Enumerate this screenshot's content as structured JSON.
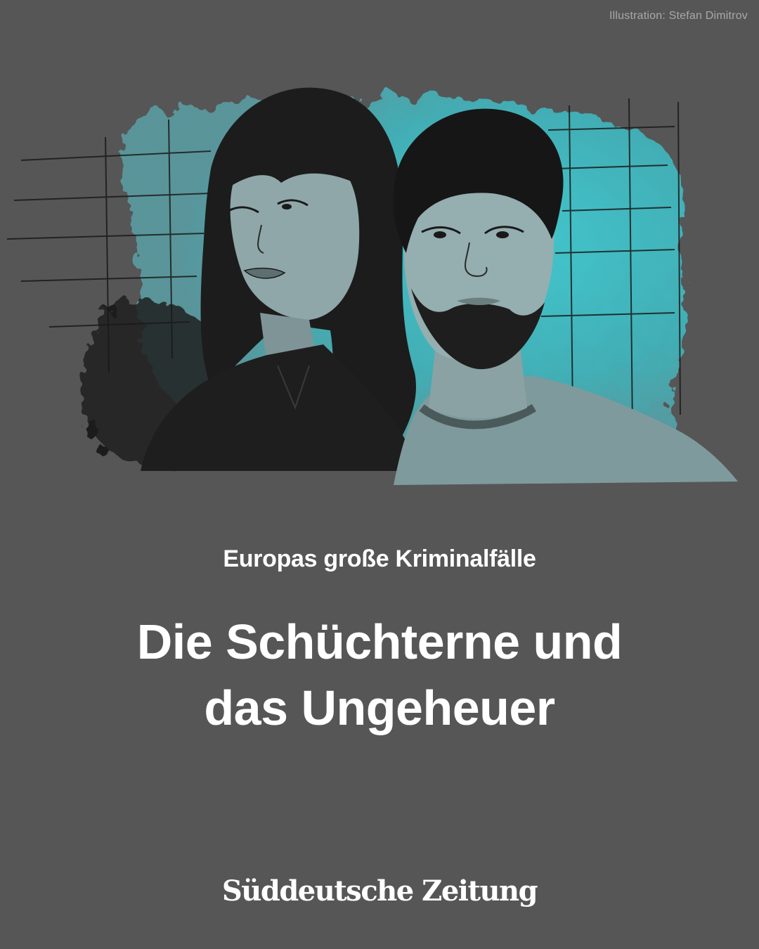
{
  "credit": "Illustration: Stefan Dimitrov",
  "kicker": "Europas große Kriminalfälle",
  "headline": {
    "line1": "Die Schüchterne und",
    "line2": "das Ungeheuer"
  },
  "brand": "Süddeutsche Zeitung",
  "colors": {
    "background": "#565656",
    "accent": "#3fc4cc",
    "text": "#ffffff"
  }
}
